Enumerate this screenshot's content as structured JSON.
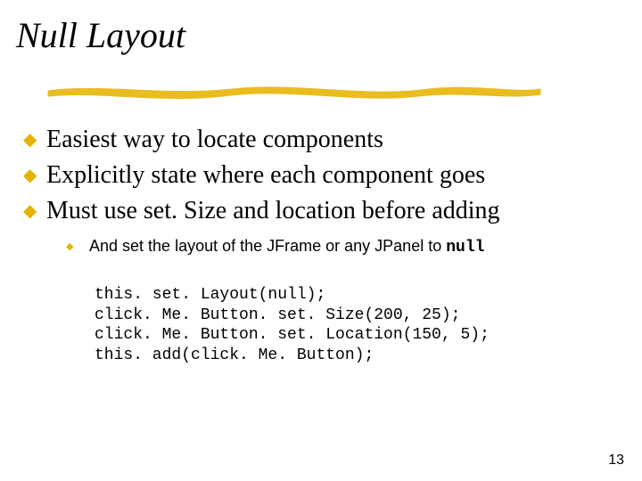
{
  "title": "Null Layout",
  "bullets": {
    "items": [
      "Easiest way to locate components",
      "Explicitly state where each component goes",
      "Must use set. Size and location before adding"
    ],
    "sub": {
      "text_prefix": "And set the layout of the JFrame or any JPanel to ",
      "code_word": "null"
    }
  },
  "code": {
    "lines": [
      "this. set. Layout(null);",
      "click. Me. Button. set. Size(200, 25);",
      "click. Me. Button. set. Location(150, 5);",
      "this. add(click. Me. Button);"
    ]
  },
  "page_number": "13"
}
